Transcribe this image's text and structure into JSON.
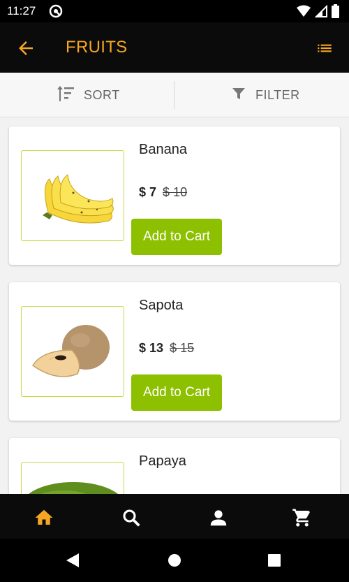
{
  "status_bar": {
    "time": "11:27"
  },
  "header": {
    "title": "FRUITS"
  },
  "toolbar": {
    "sort_label": "SORT",
    "filter_label": "FILTER"
  },
  "products": [
    {
      "name": "Banana",
      "price": "$ 7",
      "old_price": "$ 10",
      "button": "Add to Cart"
    },
    {
      "name": "Sapota",
      "price": "$ 13",
      "old_price": "$ 15",
      "button": "Add to Cart"
    },
    {
      "name": "Papaya"
    }
  ],
  "colors": {
    "accent": "#f5a623",
    "button_green": "#8dc000",
    "bar_dark": "#0b0b0b"
  },
  "nav_icons": [
    "home-icon",
    "search-icon",
    "person-icon",
    "cart-icon"
  ]
}
